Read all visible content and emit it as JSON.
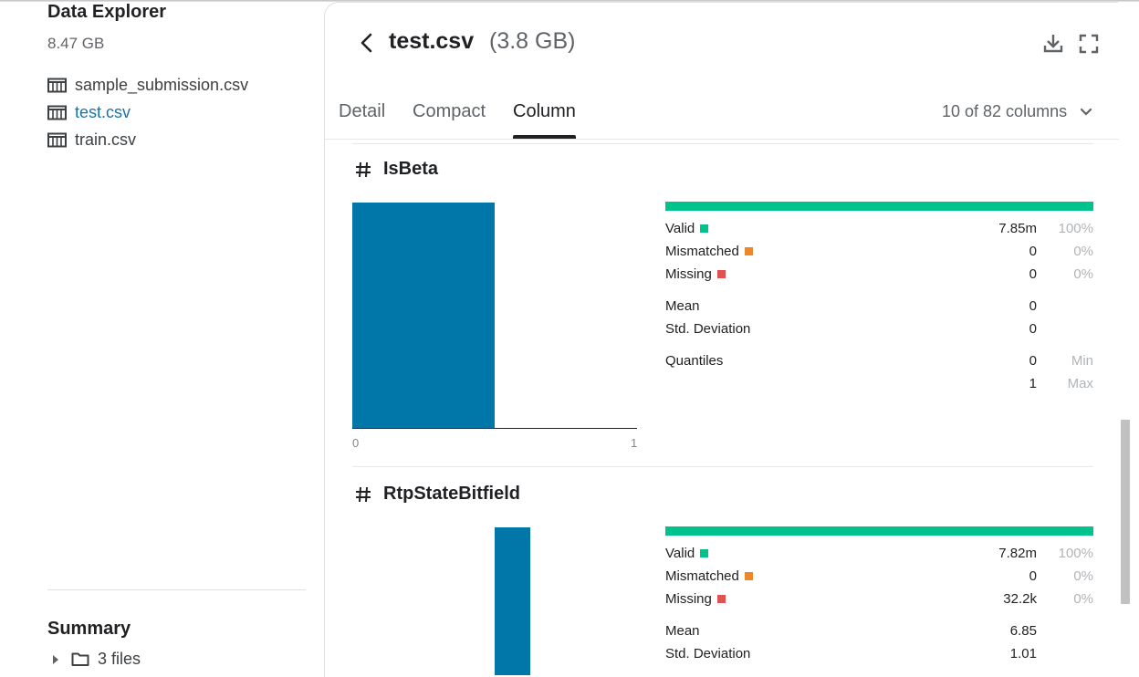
{
  "colors": {
    "accent": "#0077a8",
    "valid": "#00c28c",
    "mismatched": "#f0862c",
    "missing": "#e05252",
    "active_link": "#1a73a8"
  },
  "sidebar": {
    "title": "Data Explorer",
    "size": "8.47 GB",
    "files": [
      {
        "label": "sample_submission.csv",
        "icon": "table-icon"
      },
      {
        "label": "test.csv",
        "icon": "table-icon"
      },
      {
        "label": "train.csv",
        "icon": "table-icon"
      }
    ],
    "summary_title": "Summary",
    "summary_item": "3 files",
    "summary_icon": "folder-icon"
  },
  "header": {
    "file_name": "test.csv",
    "file_size": "(3.8 GB)",
    "icons": [
      "back-icon",
      "download-icon",
      "fullscreen-icon"
    ]
  },
  "tabs": [
    {
      "label": "Detail",
      "active": false
    },
    {
      "label": "Compact",
      "active": false
    },
    {
      "label": "Column",
      "active": true
    }
  ],
  "column_count": "10 of 82 columns",
  "columns": [
    {
      "name": "IsBeta",
      "histogram": {
        "bins": [
          1,
          0
        ],
        "x_min": "0",
        "x_max": "1"
      },
      "valid": {
        "label": "Valid",
        "value": "7.85m",
        "pct": "100%"
      },
      "mismatched": {
        "label": "Mismatched",
        "value": "0",
        "pct": "0%"
      },
      "missing": {
        "label": "Missing",
        "value": "0",
        "pct": "0%"
      },
      "mean": {
        "label": "Mean",
        "value": "0"
      },
      "std": {
        "label": "Std. Deviation",
        "value": "0"
      },
      "quantiles": {
        "label": "Quantiles",
        "min_value": "0",
        "min_label": "Min",
        "max_value": "1",
        "max_label": "Max"
      }
    },
    {
      "name": "RtpStateBitfield",
      "histogram": {
        "bins": [
          0,
          0,
          0,
          0,
          1,
          0,
          0,
          0
        ]
      },
      "valid": {
        "label": "Valid",
        "value": "7.82m",
        "pct": "100%"
      },
      "mismatched": {
        "label": "Mismatched",
        "value": "0",
        "pct": "0%"
      },
      "missing": {
        "label": "Missing",
        "value": "32.2k",
        "pct": "0%"
      },
      "mean": {
        "label": "Mean",
        "value": "6.85"
      },
      "std": {
        "label": "Std. Deviation",
        "value": "1.01"
      }
    }
  ]
}
